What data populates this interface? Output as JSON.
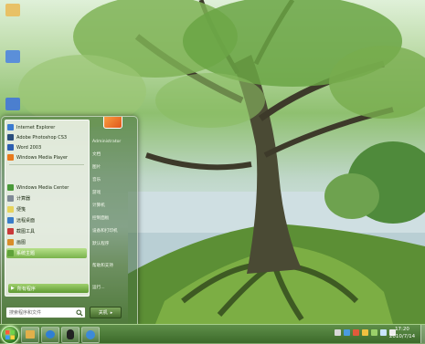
{
  "desktop": {
    "icons": [
      {
        "name": "folder-icon",
        "label": "",
        "color": "#e8c166"
      },
      {
        "name": "computer-icon",
        "label": "",
        "color": "#5b8fd9"
      },
      {
        "name": "network-icon",
        "label": "",
        "color": "#4b7fcf"
      }
    ]
  },
  "start_menu": {
    "programs": [
      {
        "label": "Internet Explorer",
        "icon": "ie-icon",
        "color": "#3b7bd0"
      },
      {
        "label": "Adobe Photoshop CS3",
        "icon": "photoshop-icon",
        "color": "#2a4e7c"
      },
      {
        "label": "Word 2003",
        "icon": "word-icon",
        "color": "#2d5fb0"
      },
      {
        "label": "Windows Media Player",
        "icon": "media-player-icon",
        "color": "#e87a1d"
      },
      {
        "label": "Windows Media Center",
        "icon": "media-center-icon",
        "color": "#4a9a3a"
      },
      {
        "label": "计算器",
        "icon": "calculator-icon",
        "color": "#7f8a96"
      },
      {
        "label": "便笺",
        "icon": "sticky-notes-icon",
        "color": "#e6d35b"
      },
      {
        "label": "远程桌面",
        "icon": "remote-desktop-icon",
        "color": "#3a7dc9"
      },
      {
        "label": "截图工具",
        "icon": "snipping-tool-icon",
        "color": "#c93a3a"
      },
      {
        "label": "画图",
        "icon": "paint-icon",
        "color": "#d98d2a"
      },
      {
        "label": "系统主题",
        "icon": "theme-icon",
        "color": "#5fa23a",
        "selected": true
      }
    ],
    "all_programs_label": "所有程序",
    "search_placeholder": "搜索程序和文件",
    "right_items": [
      "Administrator",
      "文档",
      "图片",
      "音乐",
      "游戏",
      "计算机",
      "控制面板",
      "设备和打印机",
      "默认程序",
      "帮助和支持",
      "运行..."
    ],
    "shutdown_label": "关机"
  },
  "taskbar": {
    "pinned": [
      {
        "name": "explorer-icon",
        "color": "#e2b04a"
      },
      {
        "name": "media-player-icon",
        "color": "#2f7fd4"
      },
      {
        "name": "qq-icon",
        "color": "#222222"
      },
      {
        "name": "ie-icon",
        "color": "#3c8ad8"
      }
    ],
    "clock_time": "17:20",
    "clock_date": "2010/7/14"
  }
}
